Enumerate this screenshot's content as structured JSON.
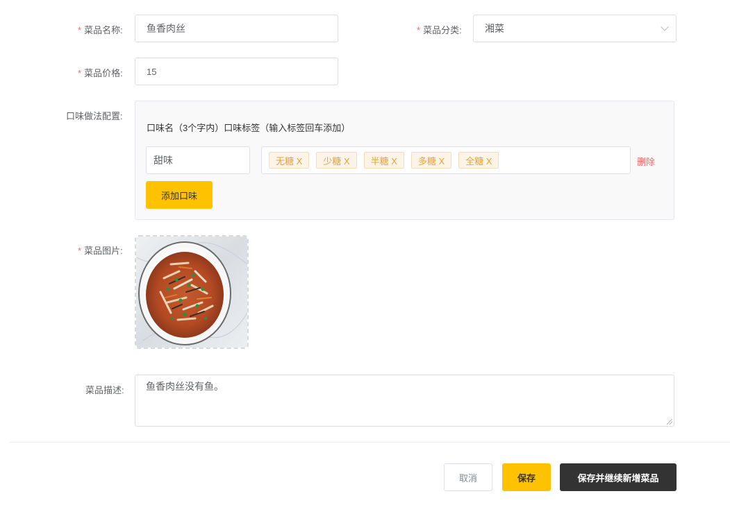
{
  "form": {
    "name": {
      "label": "菜品名称:",
      "value": "鱼香肉丝",
      "required_mark": "*"
    },
    "category": {
      "label": "菜品分类:",
      "value": "湘菜",
      "required_mark": "*"
    },
    "price": {
      "label": "菜品价格:",
      "value": "15",
      "required_mark": "*"
    },
    "flavor": {
      "label": "口味做法配置:",
      "header": "口味名（3个字内）口味标签（输入标签回车添加）",
      "name_value": "甜味",
      "tags": [
        "无糖 X",
        "少糖 X",
        "半糖 X",
        "多糖 X",
        "全糖 X"
      ],
      "delete_label": "删除",
      "add_button": "添加口味"
    },
    "image": {
      "label": "菜品图片:",
      "required_mark": "*"
    },
    "description": {
      "label": "菜品描述:",
      "value": "鱼香肉丝没有鱼。"
    }
  },
  "footer": {
    "cancel": "取消",
    "save": "保存",
    "save_continue": "保存并继续新增菜品"
  },
  "colors": {
    "accent": "#ffc200",
    "required": "#f56c6c",
    "dark_button": "#333333",
    "tag_text": "#e6a23c"
  },
  "icons": {
    "select_arrow": "chevron-down-icon",
    "textarea_resize": "resize-handle-icon"
  }
}
